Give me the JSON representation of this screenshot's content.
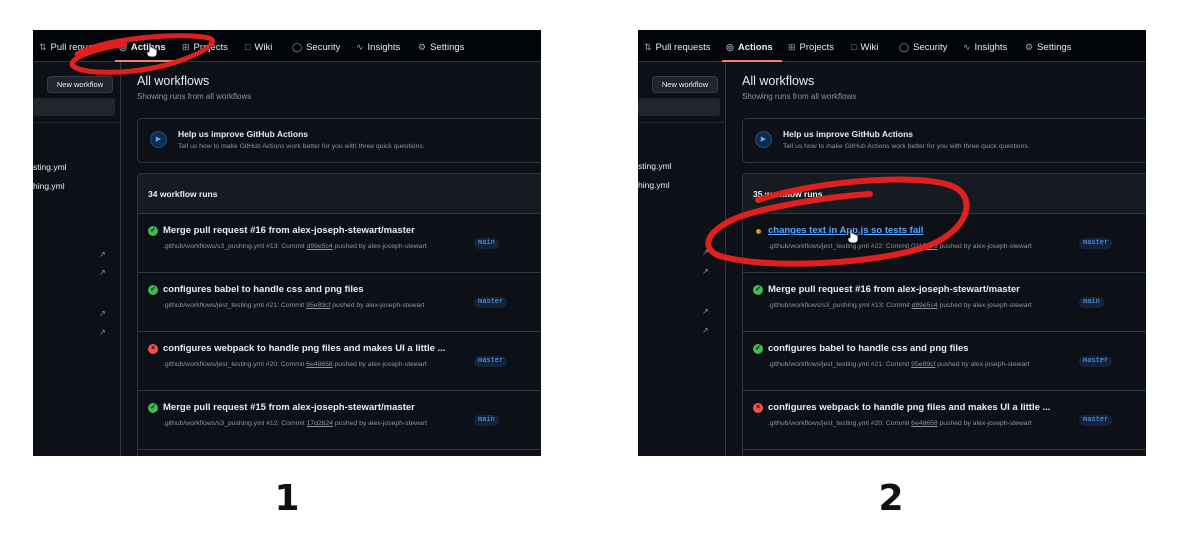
{
  "captions": {
    "first": "1",
    "second": "2"
  },
  "nav": {
    "tabs": [
      {
        "label": "Pull requests",
        "icon": "pull-request-icon"
      },
      {
        "label": "Actions",
        "icon": "play-circle-icon"
      },
      {
        "label": "Projects",
        "icon": "table-icon"
      },
      {
        "label": "Wiki",
        "icon": "book-icon"
      },
      {
        "label": "Security",
        "icon": "shield-icon"
      },
      {
        "label": "Insights",
        "icon": "graph-icon"
      },
      {
        "label": "Settings",
        "icon": "gear-icon"
      }
    ],
    "active": "Actions"
  },
  "sidebar": {
    "new_workflow_label": "New workflow",
    "items": [
      "sting.yml",
      "hing.yml"
    ]
  },
  "main": {
    "title": "All workflows",
    "subtitle": "Showing runs from all workflows",
    "banner": {
      "title": "Help us improve GitHub Actions",
      "description": "Tell us how to make GitHub Actions work better for you with three quick questions."
    }
  },
  "shot1": {
    "runs_count": "34 workflow runs",
    "runs": [
      {
        "title": "Merge pull request #16 from alex-joseph-stewart/master",
        "status": "success",
        "meta_prefix": ".github/workflows/s3_pushing.yml #13: Commit ",
        "commit": "d99e5c4",
        "meta_suffix": " pushed by alex-joseph-stewart",
        "branch": "main"
      },
      {
        "title": "configures babel to handle css and png files",
        "status": "success",
        "meta_prefix": ".github/workflows/jest_testing.yml #21: Commit ",
        "commit": "95e89cf",
        "meta_suffix": " pushed by alex-joseph-stewart",
        "branch": "master"
      },
      {
        "title": "configures webpack to handle png files and makes UI a little ...",
        "status": "failure",
        "meta_prefix": ".github/workflows/jest_testing.yml #20: Commit ",
        "commit": "6e48658",
        "meta_suffix": " pushed by alex-joseph-stewart",
        "branch": "master"
      },
      {
        "title": "Merge pull request #15 from alex-joseph-stewart/master",
        "status": "success",
        "meta_prefix": ".github/workflows/s3_pushing.yml #12: Commit ",
        "commit": "17d2b24",
        "meta_suffix": " pushed by alex-joseph-stewart",
        "branch": "main"
      }
    ]
  },
  "shot2": {
    "runs_count": "35 workflow runs",
    "runs": [
      {
        "title": "changes text in App.js so tests fail",
        "status": "pending",
        "meta_prefix": ".github/workflows/jest_testing.yml #22: Commit ",
        "commit": "0217175",
        "meta_suffix": " pushed by alex-joseph-stewart",
        "branch": "master"
      },
      {
        "title": "Merge pull request #16 from alex-joseph-stewart/master",
        "status": "success",
        "meta_prefix": ".github/workflows/s3_pushing.yml #13: Commit ",
        "commit": "d99e5c4",
        "meta_suffix": " pushed by alex-joseph-stewart",
        "branch": "main"
      },
      {
        "title": "configures babel to handle css and png files",
        "status": "success",
        "meta_prefix": ".github/workflows/jest_testing.yml #21: Commit ",
        "commit": "95e89cf",
        "meta_suffix": " pushed by alex-joseph-stewart",
        "branch": "master"
      },
      {
        "title": "configures webpack to handle png files and makes UI a little ...",
        "status": "failure",
        "meta_prefix": ".github/workflows/jest_testing.yml #20: Commit ",
        "commit": "6e48658",
        "meta_suffix": " pushed by alex-joseph-stewart",
        "branch": "master"
      }
    ]
  },
  "colors": {
    "background": "#0d1117",
    "nav_background": "#010409",
    "border": "#30363d",
    "link": "#58a6ff",
    "success": "#3fb950",
    "failure": "#f85149",
    "pending": "#d29922",
    "annotation": "#e0201e"
  }
}
